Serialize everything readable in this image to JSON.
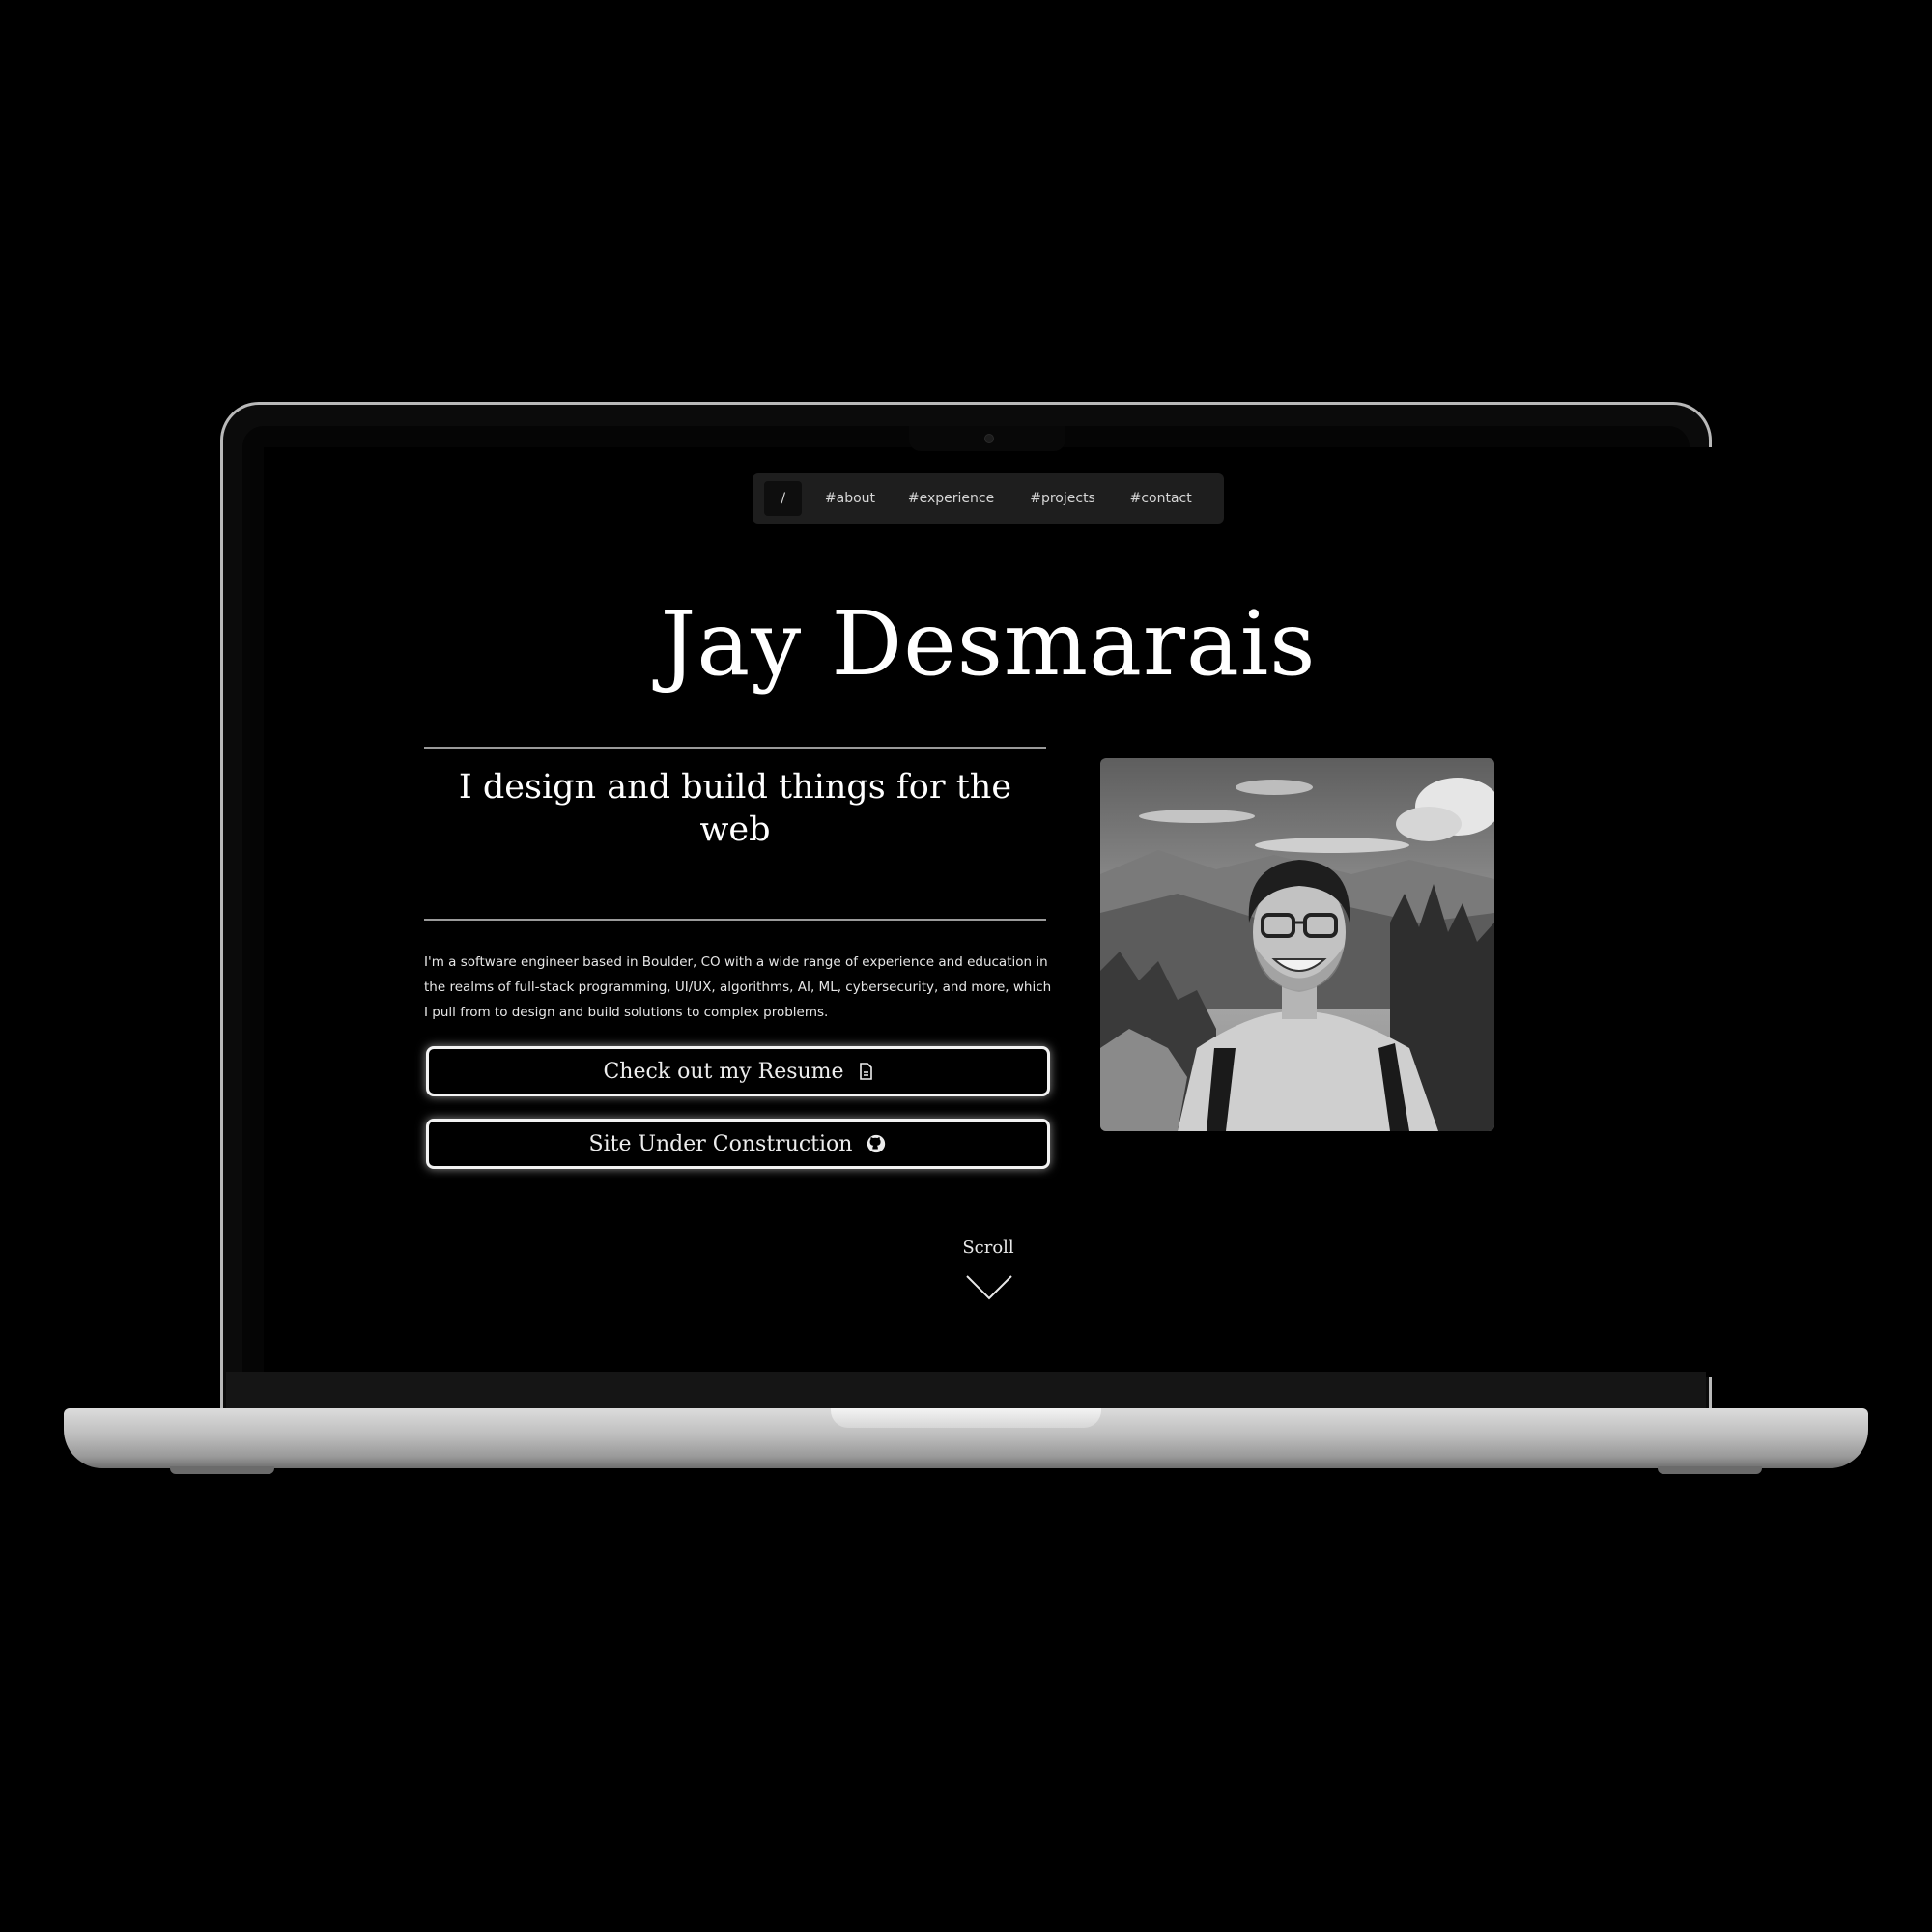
{
  "nav": {
    "items": [
      {
        "label": "/"
      },
      {
        "label": "#about"
      },
      {
        "label": "#experience"
      },
      {
        "label": "#projects"
      },
      {
        "label": "#contact"
      }
    ]
  },
  "hero": {
    "name": "Jay Desmarais",
    "tagline": "I design and build things for the web",
    "bio": "I'm a software engineer based in Boulder, CO with a wide range of experience and education in the realms of full-stack programming, UI/UX, algorithms, AI, ML, cybersecurity, and more, which I pull from to design and build solutions to complex problems.",
    "buttons": {
      "resume": {
        "label": "Check out my Resume",
        "icon": "document-icon"
      },
      "github": {
        "label": "Site Under Construction",
        "icon": "github-icon"
      }
    },
    "scroll": {
      "label": "Scroll",
      "icon": "chevron-down-icon"
    }
  },
  "colors": {
    "background": "#000000",
    "nav_bg": "#1e1e1e",
    "text": "#ffffff",
    "rule": "#9a9a9a",
    "button_border": "#f2f2f2"
  }
}
